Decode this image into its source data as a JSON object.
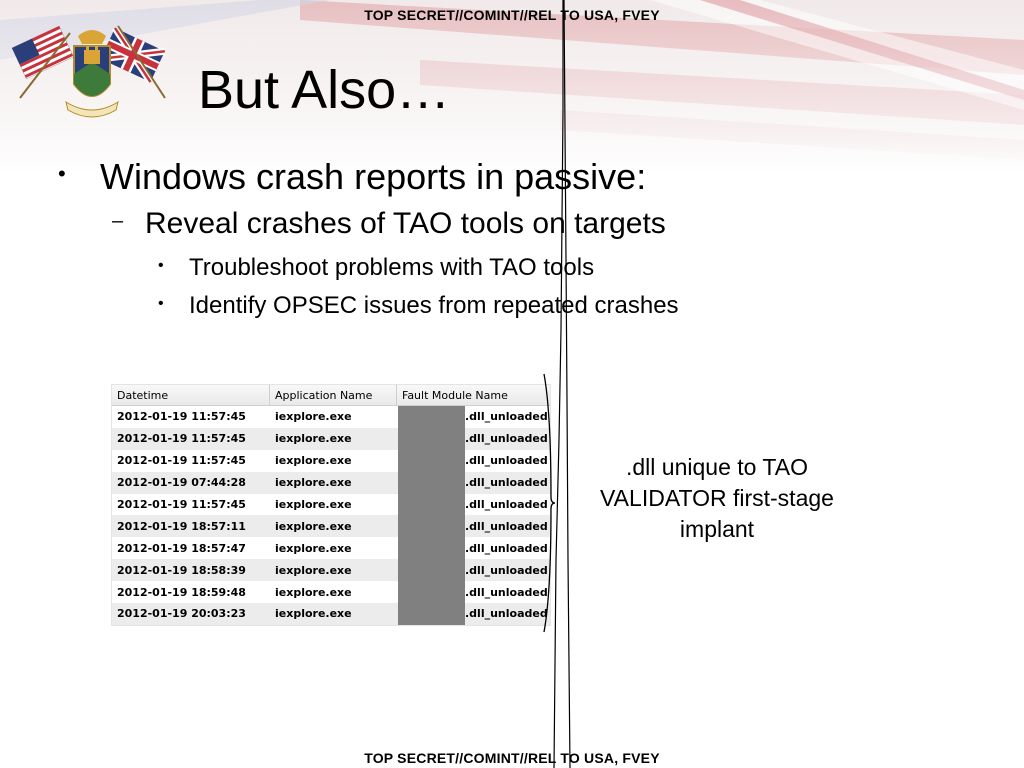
{
  "classification": {
    "top": "TOP SECRET//COMINT//REL TO USA, FVEY",
    "bottom": "TOP SECRET//COMINT//REL TO USA, FVEY"
  },
  "logo": {
    "icon": "agency-seal-with-us-and-uk-flags-icon"
  },
  "title": "But Also…",
  "bullets": {
    "level1": {
      "marker": "•",
      "text": "Windows crash reports in passive:"
    },
    "level2": {
      "marker": "–",
      "text": "Reveal crashes of TAO tools on targets"
    },
    "level3": [
      {
        "marker": "•",
        "text": "Troubleshoot problems with TAO tools"
      },
      {
        "marker": "•",
        "text": "Identify OPSEC issues from repeated crashes"
      }
    ]
  },
  "table": {
    "headers": [
      "Datetime",
      "Application Name",
      "Fault Module Name"
    ],
    "rows": [
      [
        "2012-01-19 11:57:45",
        "iexplore.exe",
        ".dll_unloaded"
      ],
      [
        "2012-01-19 11:57:45",
        "iexplore.exe",
        ".dll_unloaded"
      ],
      [
        "2012-01-19 11:57:45",
        "iexplore.exe",
        ".dll_unloaded"
      ],
      [
        "2012-01-19 07:44:28",
        "iexplore.exe",
        ".dll_unloaded"
      ],
      [
        "2012-01-19 11:57:45",
        "iexplore.exe",
        ".dll_unloaded"
      ],
      [
        "2012-01-19 18:57:11",
        "iexplore.exe",
        ".dll_unloaded"
      ],
      [
        "2012-01-19 18:57:47",
        "iexplore.exe",
        ".dll_unloaded"
      ],
      [
        "2012-01-19 18:58:39",
        "iexplore.exe",
        ".dll_unloaded"
      ],
      [
        "2012-01-19 18:59:48",
        "iexplore.exe",
        ".dll_unloaded"
      ],
      [
        "2012-01-19 20:03:23",
        "iexplore.exe",
        ".dll_unloaded"
      ]
    ]
  },
  "annotation": {
    "lines": [
      ".dll unique to TAO",
      "VALIDATOR first-stage",
      "implant"
    ]
  },
  "colors": {
    "redaction": "#808080",
    "flag_red": "#c8323c",
    "flag_blue": "#2a3f7a"
  }
}
